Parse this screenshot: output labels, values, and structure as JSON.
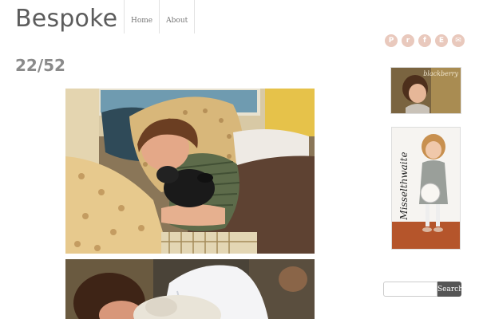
{
  "header": {
    "site_title": "Bespoke",
    "nav": [
      {
        "label": "Home"
      },
      {
        "label": "About"
      }
    ]
  },
  "social_icons": [
    {
      "name": "pinterest-icon",
      "glyph": "P"
    },
    {
      "name": "rss-icon",
      "glyph": "r"
    },
    {
      "name": "facebook-icon",
      "glyph": "f"
    },
    {
      "name": "etsy-icon",
      "glyph": "E"
    },
    {
      "name": "email-icon",
      "glyph": "✉"
    }
  ],
  "post": {
    "title": "22/52"
  },
  "sidebar": {
    "banner1_text": "blackberry",
    "banner2_text": "Misselthwaite",
    "search": {
      "value": "",
      "button_label": "Search"
    }
  },
  "colors": {
    "social_icon": "#e9c9bd",
    "search_button": "#555555"
  }
}
